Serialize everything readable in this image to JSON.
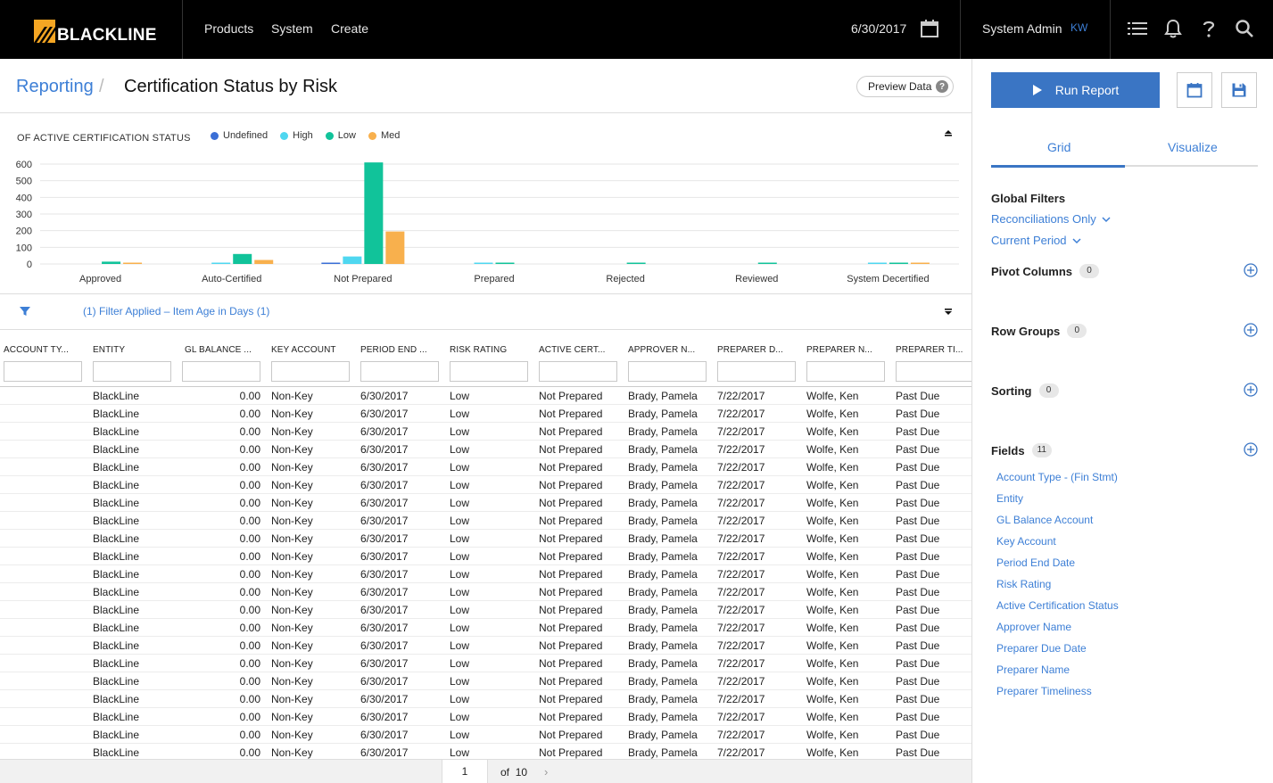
{
  "topbar": {
    "brand": "BLACKLINE",
    "nav": [
      "Products",
      "System",
      "Create"
    ],
    "date": "6/30/2017",
    "user": "System Admin",
    "initials": "KW"
  },
  "breadcrumb": {
    "parent": "Reporting",
    "separator": "/",
    "title": "Certification Status by Risk"
  },
  "preview_label": "Preview Data",
  "chart_data": {
    "type": "bar",
    "title": "OF ACTIVE CERTIFICATION STATUS",
    "categories": [
      "Approved",
      "Auto-Certified",
      "Not Prepared",
      "Prepared",
      "Rejected",
      "Reviewed",
      "System Decertified"
    ],
    "series": [
      {
        "name": "Undefined",
        "color": "#3b6fd6",
        "values": [
          0,
          0,
          5,
          0,
          0,
          0,
          0
        ]
      },
      {
        "name": "High",
        "color": "#4fd7f0",
        "values": [
          0,
          2,
          45,
          2,
          0,
          0,
          2
        ]
      },
      {
        "name": "Low",
        "color": "#11c39a",
        "values": [
          14,
          60,
          610,
          5,
          4,
          3,
          4
        ]
      },
      {
        "name": "Med",
        "color": "#f8b04d",
        "values": [
          3,
          24,
          195,
          0,
          0,
          0,
          1
        ]
      }
    ],
    "yticks": [
      0,
      100,
      200,
      300,
      400,
      500,
      600
    ],
    "ylim": [
      0,
      620
    ],
    "grid": true,
    "legend_position": "top"
  },
  "filter_text": "(1) Filter Applied – Item Age in Days (1)",
  "grid": {
    "columns": [
      "ACCOUNT TY...",
      "ENTITY",
      "GL BALANCE ...",
      "KEY ACCOUNT",
      "PERIOD END ...",
      "RISK RATING",
      "ACTIVE CERT...",
      "APPROVER N...",
      "PREPARER D...",
      "PREPARER N...",
      "PREPARER TI..."
    ],
    "row": [
      "",
      "BlackLine",
      "0.00",
      "Non-Key",
      "6/30/2017",
      "Low",
      "Not Prepared",
      "Brady, Pamela",
      "7/22/2017",
      "Wolfe, Ken",
      "Past Due"
    ],
    "row_count": 21
  },
  "pager": {
    "page": "1",
    "of_label": "of",
    "total": "10"
  },
  "side": {
    "run_label": "Run Report",
    "tabs": [
      "Grid",
      "Visualize"
    ],
    "global_filters_title": "Global Filters",
    "global_filters": [
      "Reconciliations Only",
      "Current Period"
    ],
    "pivot_title": "Pivot Columns",
    "pivot_count": "0",
    "rowgroups_title": "Row Groups",
    "rowgroups_count": "0",
    "sorting_title": "Sorting",
    "sorting_count": "0",
    "fields_title": "Fields",
    "fields_count": "11",
    "fields": [
      "Account Type - (Fin Stmt)",
      "Entity",
      "GL Balance Account",
      "Key Account",
      "Period End Date",
      "Risk Rating",
      "Active Certification Status",
      "Approver Name",
      "Preparer Due Date",
      "Preparer Name",
      "Preparer Timeliness"
    ]
  },
  "icons": {
    "calendar": "calendar-icon",
    "list": "list-icon",
    "bell": "bell-icon",
    "help": "help-icon",
    "search": "search-icon",
    "save": "save-icon",
    "play": "play-icon",
    "filter": "filter-icon"
  }
}
